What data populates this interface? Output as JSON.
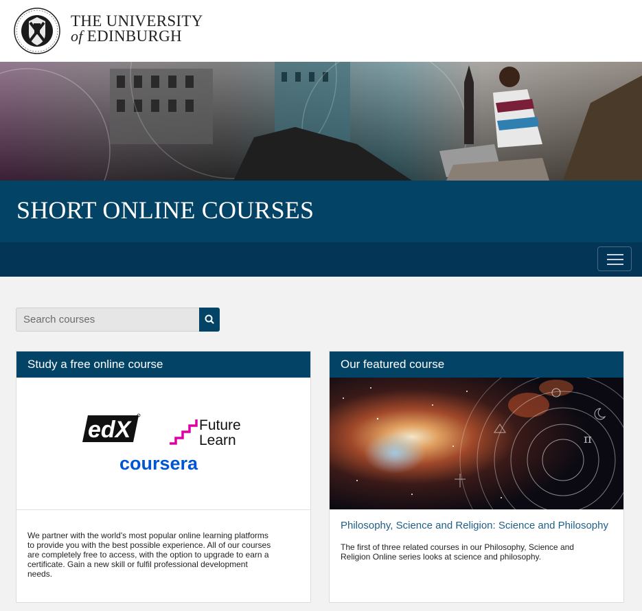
{
  "header": {
    "university_line1": "THE UNIVERSITY",
    "university_line2_prefix": "of",
    "university_line2": "EDINBURGH",
    "crest_icon": "university-crest-icon"
  },
  "hero": {
    "image": "hero-banner-image"
  },
  "title_band": {
    "title": "SHORT ONLINE COURSES"
  },
  "nav": {
    "menu_icon": "hamburger-menu-icon"
  },
  "search": {
    "placeholder": "Search courses",
    "value": "",
    "button_icon": "search-icon"
  },
  "cards": {
    "free_course": {
      "heading": "Study a free online course",
      "logos": {
        "edx": "edX",
        "futurelearn_line1": "Future",
        "futurelearn_line2": "Learn",
        "coursera": "coursera"
      },
      "body_lines": [
        "We partner with the world's most popular online learning platforms",
        "to provide you with the best possible experience. All of our courses",
        "are completely free to access, with the option to upgrade to earn a",
        "certificate. Gain a new skill or fulfil professional development",
        "needs."
      ]
    },
    "featured": {
      "heading": "Our featured course",
      "course_title": "Philosophy, Science and Religion: Science and Philosophy",
      "body_lines": [
        "The first of three related courses in our Philosophy, Science and",
        "Religion Online series looks at science and philosophy."
      ]
    }
  },
  "colors": {
    "brand_blue": "#034366",
    "nav_blue": "#033656",
    "link_blue": "#1f5f86",
    "futurelearn_pink": "#de00a5",
    "coursera_blue": "#0056d2"
  }
}
